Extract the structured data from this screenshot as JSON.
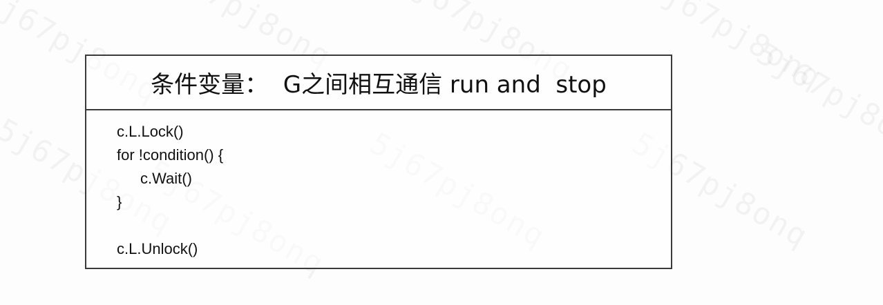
{
  "diagram": {
    "title": "条件变量：  G之间相互通信 run and  stop",
    "code_lines": [
      "c.L.Lock()",
      "for !condition() {",
      "c.Wait()",
      "}",
      "",
      "c.L.Unlock()"
    ]
  },
  "watermark": {
    "text": "5j67pj8onq"
  }
}
